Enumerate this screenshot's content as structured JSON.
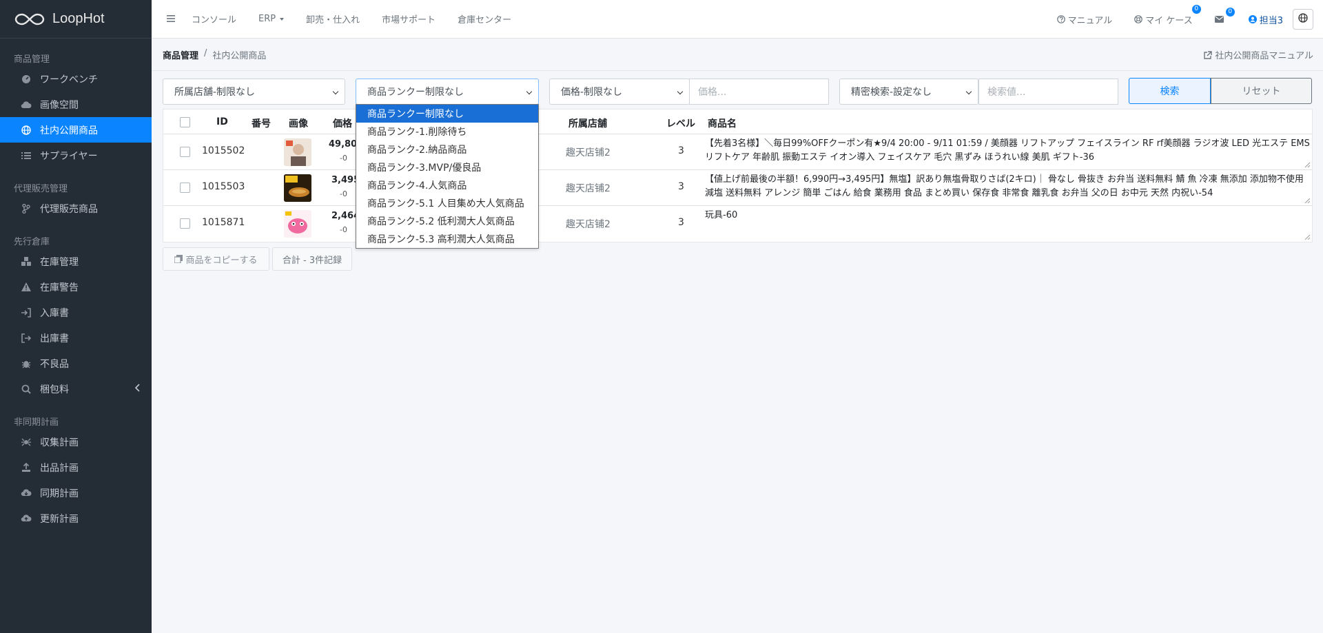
{
  "brand": {
    "name": "LoopHot"
  },
  "sidebar": {
    "sections": [
      {
        "title": "商品管理",
        "items": [
          {
            "label": "ワークベンチ",
            "icon": "dashboard-icon"
          },
          {
            "label": "画像空間",
            "icon": "cloud-icon"
          },
          {
            "label": "社内公開商品",
            "icon": "globe-icon",
            "active": true
          },
          {
            "label": "サプライヤー",
            "icon": "list-icon"
          }
        ]
      },
      {
        "title": "代理販売管理",
        "items": [
          {
            "label": "代理販売商品",
            "icon": "branch-icon"
          }
        ]
      },
      {
        "title": "先行倉庫",
        "items": [
          {
            "label": "在庫管理",
            "icon": "boxes-icon"
          },
          {
            "label": "在庫警告",
            "icon": "warning-icon"
          },
          {
            "label": "入庫書",
            "icon": "sign-in-icon"
          },
          {
            "label": "出庫書",
            "icon": "sign-out-icon"
          },
          {
            "label": "不良品",
            "icon": "bug-icon"
          },
          {
            "label": "梱包料",
            "icon": "search-box-icon",
            "chevron": true
          }
        ]
      },
      {
        "title": "非同期計画",
        "items": [
          {
            "label": "収集計画",
            "icon": "spider-icon"
          },
          {
            "label": "出品計画",
            "icon": "upload-icon"
          },
          {
            "label": "同期計画",
            "icon": "cloud-download-icon"
          },
          {
            "label": "更新計画",
            "icon": "cloud-upload-icon"
          }
        ]
      }
    ]
  },
  "topbar": {
    "nav": [
      "コンソール",
      "ERP",
      "卸売・仕入れ",
      "市場サポート",
      "倉庫センター"
    ],
    "right": {
      "manual": "マニュアル",
      "my_case": "マイ ケース",
      "my_case_badge": "0",
      "mail_badge": "0",
      "user": "担当3"
    }
  },
  "breadcrumb": {
    "first": "商品管理",
    "sep": "/",
    "current": "社内公開商品"
  },
  "manual_link": "社内公開商品マニュアル",
  "filters": {
    "store": "所属店舗-制限なし",
    "rank": "商品ランクー制限なし",
    "price_select": "価格-制限なし",
    "price_placeholder": "価格...",
    "advanced": "精密検索-設定なし",
    "search_placeholder": "検索値...",
    "search_btn": "検索",
    "reset_btn": "リセット"
  },
  "table": {
    "headers": {
      "id": "ID",
      "number": "番号",
      "image": "画像",
      "price": "価格",
      "store": "所属店舗",
      "level": "レベル",
      "name": "商品名"
    },
    "rows": [
      {
        "id": "1015502",
        "price": "49,800",
        "price_sub": "-0",
        "store": "趣天店铺2",
        "level": "3",
        "name": "【先着3名様】＼毎日99%OFFクーポン有★9/4 20:00 - 9/11 01:59 / 美顔器 リフトアップ フェイスライン RF rf美顔器 ラジオ波 LED 光エステ EMS リフトケア 年齢肌 振動エステ イオン導入 フェイスケア 毛穴 黒ずみ ほうれい線 美肌 ギフト-36",
        "thumb_color": "#d9c6b8"
      },
      {
        "id": "1015503",
        "price": "3,495",
        "price_sub": "-0",
        "store": "趣天店铺2",
        "level": "3",
        "name": "【値上げ前最後の半額！6,990円→3,495円】無塩】訳あり無塩骨取りさば(2キロ)｜ 骨なし 骨抜き お弁当 送料無料 鯖 魚 冷凍 無添加 添加物不使用 減塩 送料無料 アレンジ 簡単 ごはん 給食 業務用 食品 まとめ買い 保存食 非常食 離乳食 お弁当 父の日 お中元 天然 内祝い-54",
        "thumb_color": "#3b2a12"
      },
      {
        "id": "1015871",
        "price": "2,464",
        "price_sub": "-0",
        "store": "趣天店铺2",
        "level": "3",
        "name": "玩具-60",
        "thumb_color": "#f3b8c8"
      }
    ]
  },
  "bottom": {
    "copy": "商品をコピーする",
    "total": "合計 - 3件記録"
  },
  "rank_dropdown": [
    "商品ランクー制限なし",
    "商品ランク-1.削除待ち",
    "商品ランク-2.納品商品",
    "商品ランク-3.MVP/優良品",
    "商品ランク-4.人気商品",
    "商品ランク-5.1 人目集め大人気商品",
    "商品ランク-5.2 低利潤大人気商品",
    "商品ランク-5.3 高利潤大人気商品"
  ],
  "colors": {
    "accent": "#0a84ff",
    "sidebar_bg": "#242c35"
  }
}
